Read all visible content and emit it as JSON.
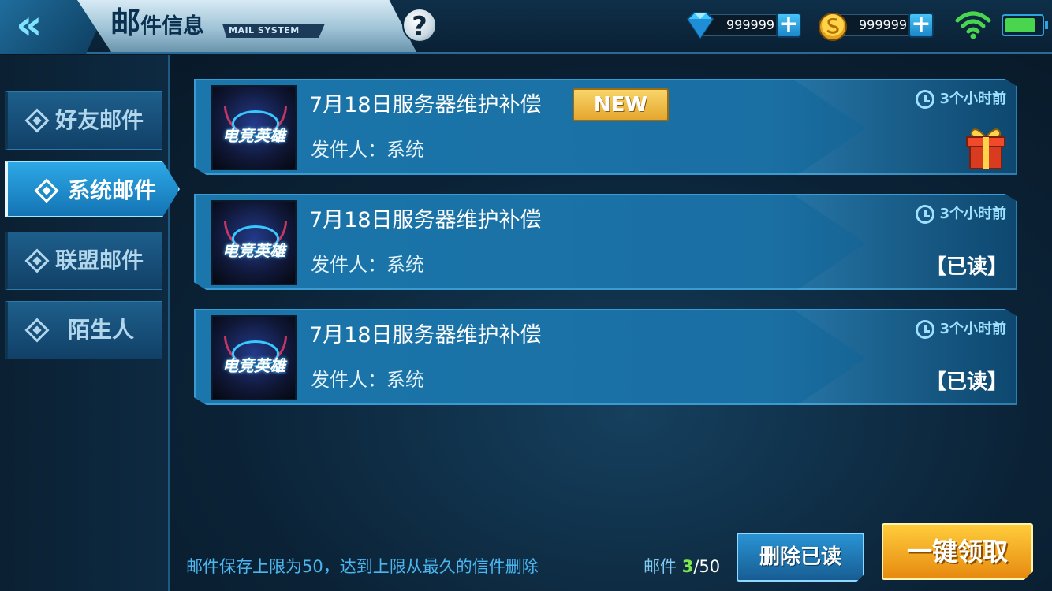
{
  "header": {
    "title_big": "邮",
    "title_rest": "件信息",
    "subtitle": "MAIL SYSTEM",
    "help_label": "?",
    "diamonds": "999999",
    "gold": "999999",
    "plus_label": "+",
    "back_label": "«"
  },
  "sidebar": {
    "items": [
      {
        "label": "好友邮件"
      },
      {
        "label": "系统邮件"
      },
      {
        "label": "联盟邮件"
      },
      {
        "label": "陌生人"
      }
    ],
    "active_index": 1
  },
  "mails": [
    {
      "title": "7月18日服务器维护补偿",
      "sender": "发件人：系统",
      "time": "3个小时前",
      "badge": "NEW",
      "status": "",
      "logo": "电竞英雄"
    },
    {
      "title": "7月18日服务器维护补偿",
      "sender": "发件人：系统",
      "time": "3个小时前",
      "badge": "",
      "status": "【已读】",
      "logo": "电竞英雄"
    },
    {
      "title": "7月18日服务器维护补偿",
      "sender": "发件人：系统",
      "time": "3个小时前",
      "badge": "",
      "status": "【已读】",
      "logo": "电竞英雄"
    }
  ],
  "footer": {
    "note": "邮件保存上限为50，达到上限从最久的信件删除",
    "count_label": "邮件 ",
    "count_current": "3",
    "count_total": "/50",
    "delete_label": "删除已读",
    "claim_label": "一键领取"
  },
  "colors": {
    "accent": "#2da8e6",
    "claim": "#f5a623",
    "new_badge": "#f0c04a",
    "battery": "#49d54d"
  },
  "battery_level": 0.85,
  "icons": [
    "back-chevron-icon",
    "help-icon",
    "diamond-icon",
    "gold-coin-icon",
    "wifi-icon",
    "battery-icon",
    "clock-icon",
    "gift-icon"
  ]
}
